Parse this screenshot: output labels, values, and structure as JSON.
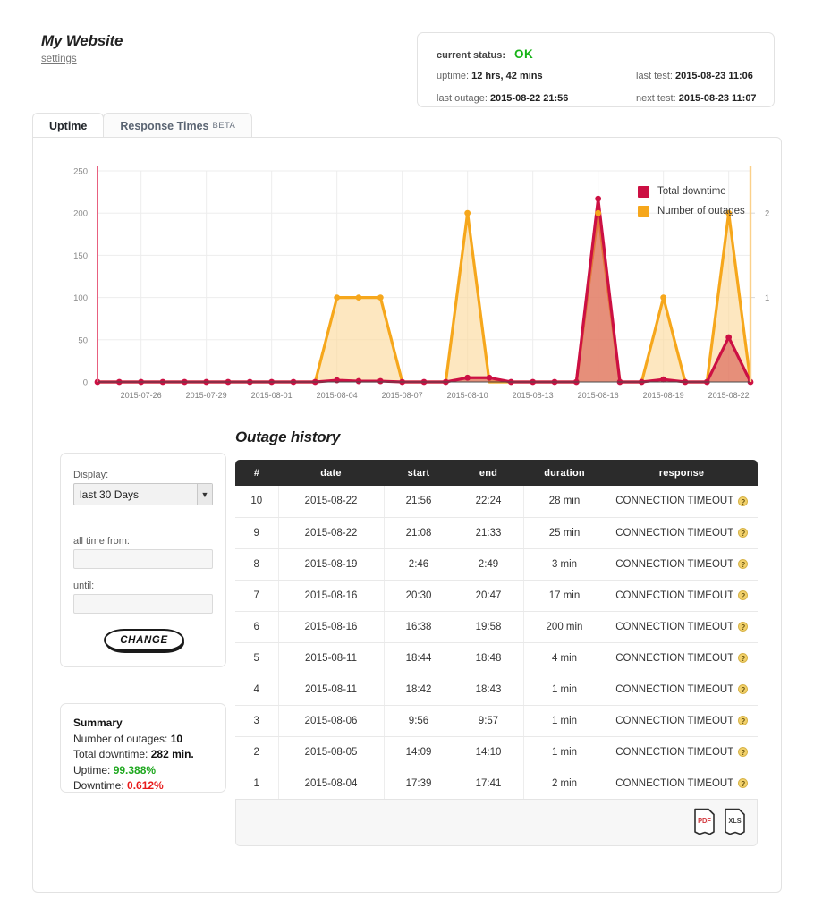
{
  "header": {
    "site_title": "My Website",
    "settings_link": "settings",
    "status": {
      "current_status_label": "current status:",
      "current_status_value": "OK",
      "uptime_label": "uptime:",
      "uptime_value": "12 hrs, 42 mins",
      "last_outage_label": "last outage:",
      "last_outage_value": "2015-08-22 21:56",
      "last_test_label": "last test:",
      "last_test_value": "2015-08-23 11:06",
      "next_test_label": "next test:",
      "next_test_value": "2015-08-23 11:07"
    }
  },
  "tabs": [
    {
      "label": "Uptime",
      "beta": "",
      "active": true
    },
    {
      "label": "Response Times",
      "beta": "BETA",
      "active": false
    }
  ],
  "chart_data": {
    "type": "line",
    "title": "",
    "xlabel": "",
    "ylabel": "",
    "grid": true,
    "legend_position": "top-right",
    "ylim": [
      0,
      250
    ],
    "yticks": [
      0,
      50,
      100,
      150,
      200,
      250
    ],
    "y2lim": [
      0,
      2.5
    ],
    "y2ticks": [
      1,
      2
    ],
    "xtick_labels": [
      "2015-07-26",
      "2015-07-29",
      "2015-08-01",
      "2015-08-04",
      "2015-08-07",
      "2015-08-10",
      "2015-08-13",
      "2015-08-16",
      "2015-08-19",
      "2015-08-22"
    ],
    "x": [
      "2015-07-24",
      "2015-07-25",
      "2015-07-26",
      "2015-07-27",
      "2015-07-28",
      "2015-07-29",
      "2015-07-30",
      "2015-07-31",
      "2015-08-01",
      "2015-08-02",
      "2015-08-03",
      "2015-08-04",
      "2015-08-05",
      "2015-08-06",
      "2015-08-07",
      "2015-08-08",
      "2015-08-09",
      "2015-08-10",
      "2015-08-11",
      "2015-08-12",
      "2015-08-13",
      "2015-08-14",
      "2015-08-15",
      "2015-08-16",
      "2015-08-17",
      "2015-08-18",
      "2015-08-19",
      "2015-08-20",
      "2015-08-21",
      "2015-08-22",
      "2015-08-23"
    ],
    "series": [
      {
        "name": "Total downtime",
        "color": "#cc1043",
        "fill": "#d9584f",
        "axis": "left",
        "unit": "min",
        "values": [
          0,
          0,
          0,
          0,
          0,
          0,
          0,
          0,
          0,
          0,
          0,
          2,
          1,
          1,
          0,
          0,
          0,
          5,
          5,
          0,
          0,
          0,
          0,
          217,
          0,
          0,
          3,
          0,
          0,
          53,
          0
        ]
      },
      {
        "name": "Number of outages",
        "color": "#f6a71c",
        "fill": "#fbd89a",
        "axis": "right",
        "unit": "outages",
        "values": [
          0,
          0,
          0,
          0,
          0,
          0,
          0,
          0,
          0,
          0,
          0,
          1,
          1,
          1,
          0,
          0,
          0,
          2,
          0,
          0,
          0,
          0,
          0,
          2,
          0,
          0,
          1,
          0,
          0,
          2,
          0
        ]
      }
    ]
  },
  "legend": [
    {
      "label": "Total downtime",
      "color": "#cc1043"
    },
    {
      "label": "Number of outages",
      "color": "#f6a71c"
    }
  ],
  "controls": {
    "display_label": "Display:",
    "display_value": "last 30 Days",
    "display_options": [
      "last 30 Days"
    ],
    "from_label": "all time from:",
    "from_value": "",
    "from_placeholder": "",
    "until_label": "until:",
    "until_value": "",
    "until_placeholder": "",
    "change_button": "CHANGE"
  },
  "summary": {
    "title": "Summary",
    "outages_label": "Number of outages:",
    "outages_value": "10",
    "downtime_label": "Total downtime:",
    "downtime_value": "282 min.",
    "uptime_label": "Uptime:",
    "uptime_value": "99.388%",
    "downtime_pct_label": "Downtime:",
    "downtime_pct_value": "0.612%"
  },
  "history": {
    "title": "Outage history",
    "columns": [
      "#",
      "date",
      "start",
      "end",
      "duration",
      "response"
    ],
    "rows": [
      {
        "n": "10",
        "date": "2015-08-22",
        "start": "21:56",
        "end": "22:24",
        "duration": "28 min",
        "response": "CONNECTION TIMEOUT"
      },
      {
        "n": "9",
        "date": "2015-08-22",
        "start": "21:08",
        "end": "21:33",
        "duration": "25 min",
        "response": "CONNECTION TIMEOUT"
      },
      {
        "n": "8",
        "date": "2015-08-19",
        "start": "2:46",
        "end": "2:49",
        "duration": "3 min",
        "response": "CONNECTION TIMEOUT"
      },
      {
        "n": "7",
        "date": "2015-08-16",
        "start": "20:30",
        "end": "20:47",
        "duration": "17 min",
        "response": "CONNECTION TIMEOUT"
      },
      {
        "n": "6",
        "date": "2015-08-16",
        "start": "16:38",
        "end": "19:58",
        "duration": "200 min",
        "response": "CONNECTION TIMEOUT"
      },
      {
        "n": "5",
        "date": "2015-08-11",
        "start": "18:44",
        "end": "18:48",
        "duration": "4 min",
        "response": "CONNECTION TIMEOUT"
      },
      {
        "n": "4",
        "date": "2015-08-11",
        "start": "18:42",
        "end": "18:43",
        "duration": "1 min",
        "response": "CONNECTION TIMEOUT"
      },
      {
        "n": "3",
        "date": "2015-08-06",
        "start": "9:56",
        "end": "9:57",
        "duration": "1 min",
        "response": "CONNECTION TIMEOUT"
      },
      {
        "n": "2",
        "date": "2015-08-05",
        "start": "14:09",
        "end": "14:10",
        "duration": "1 min",
        "response": "CONNECTION TIMEOUT"
      },
      {
        "n": "1",
        "date": "2015-08-04",
        "start": "17:39",
        "end": "17:41",
        "duration": "2 min",
        "response": "CONNECTION TIMEOUT"
      }
    ],
    "help_badge": "?",
    "exports": [
      {
        "name": "pdf-export-icon",
        "label": "PDF",
        "color": "#d2353a"
      },
      {
        "name": "xls-export-icon",
        "label": "XLS",
        "color": "#3c3c3c"
      }
    ]
  }
}
